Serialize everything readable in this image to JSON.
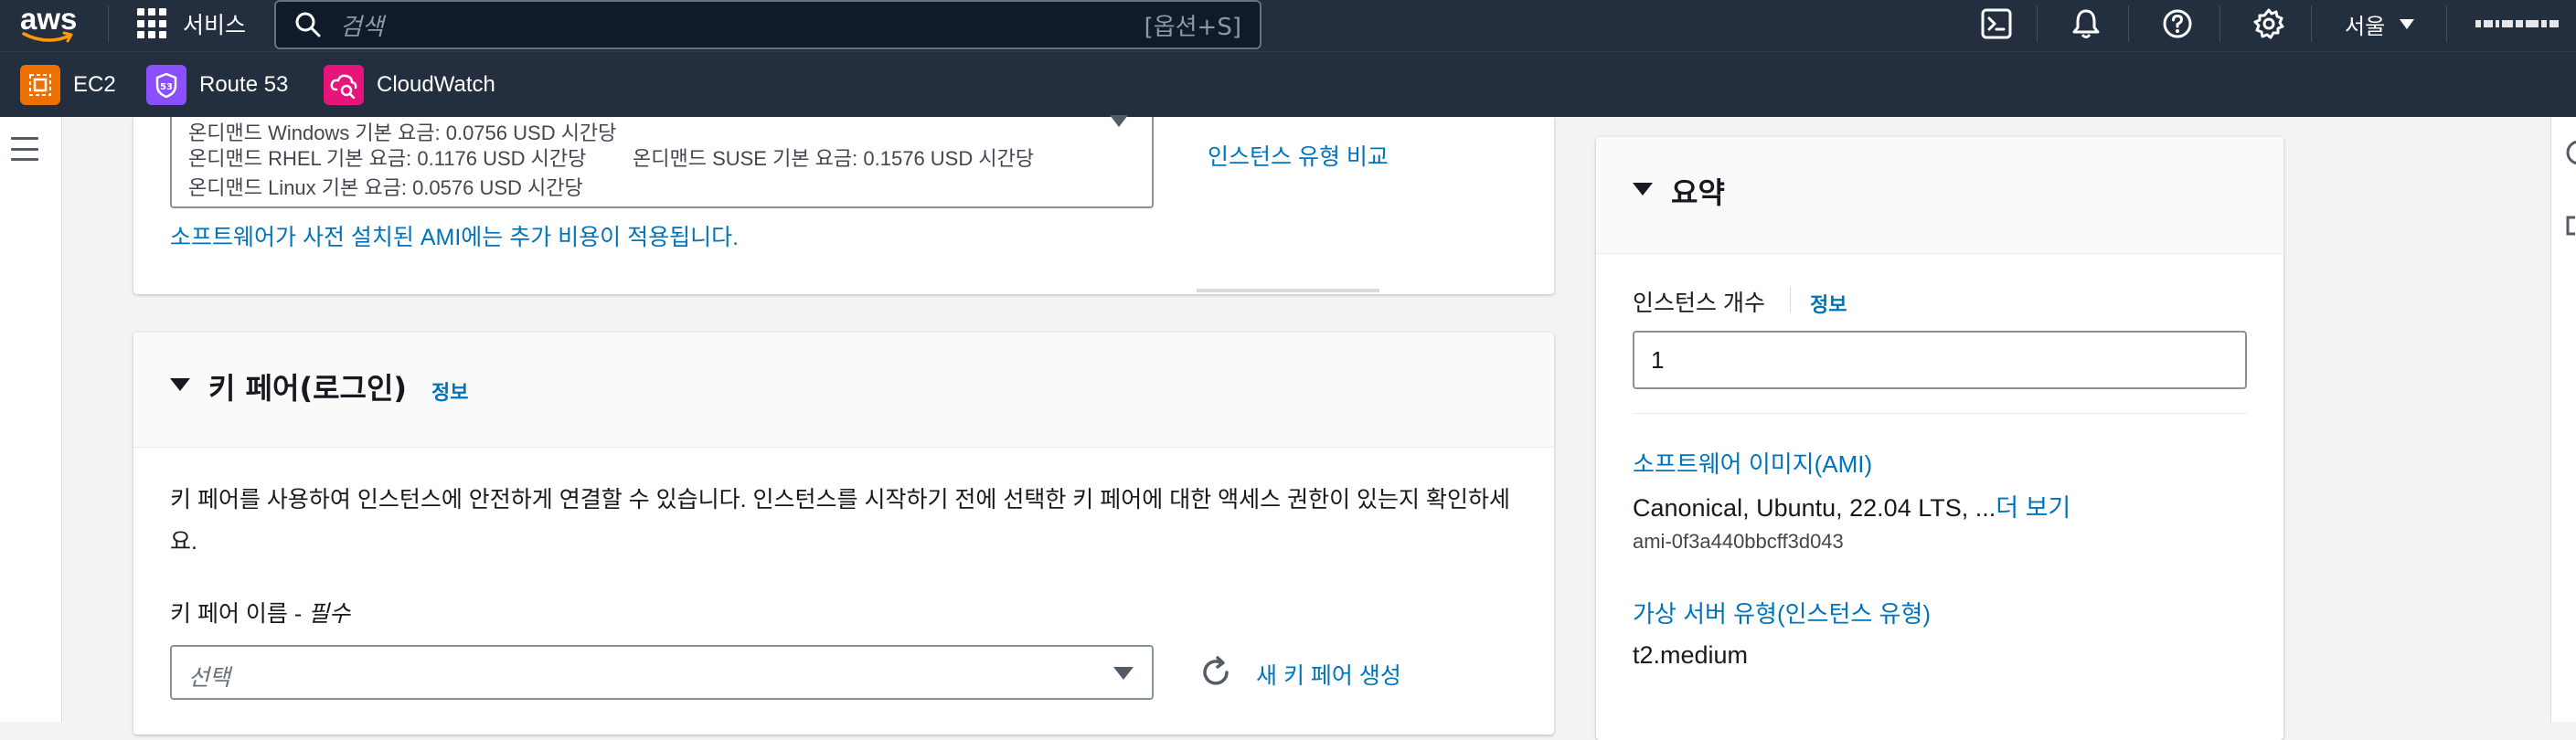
{
  "topnav": {
    "logo": "aws",
    "services_label": "서비스",
    "search_placeholder": "검색",
    "search_shortcut": "[옵션+S]",
    "region_label": "서울",
    "icons": [
      "cloudshell-icon",
      "bell-icon",
      "help-icon",
      "settings-icon"
    ]
  },
  "favorites": [
    {
      "label": "EC2",
      "icon": "ec2-icon",
      "color": "#ed7100"
    },
    {
      "label": "Route 53",
      "icon": "route53-icon",
      "color": "#8c4fff"
    },
    {
      "label": "CloudWatch",
      "icon": "cloudwatch-icon",
      "color": "#e7157b"
    }
  ],
  "instance_type_panel": {
    "price_windows": "온디맨드 Windows 기본 요금: 0.0756 USD 시간당",
    "price_rhel": "온디맨드 RHEL 기본 요금: 0.1176 USD 시간당",
    "price_suse": "온디맨드 SUSE 기본 요금: 0.1576 USD 시간당",
    "price_linux": "온디맨드 Linux 기본 요금: 0.0576 USD 시간당",
    "compare_link": "인스턴스 유형 비교",
    "ami_note": "소프트웨어가 사전 설치된 AMI에는 추가 비용이 적용됩니다."
  },
  "keypair_panel": {
    "title": "키 페어(로그인)",
    "info": "정보",
    "description": "키 페어를 사용하여 인스턴스에 안전하게 연결할 수 있습니다. 인스턴스를 시작하기 전에 선택한 키 페어에 대한 액세스 권한이 있는지 확인하세요.",
    "name_label": "키 페어 이름 - ",
    "required": "필수",
    "select_placeholder": "선택",
    "create_link": "새 키 페어 생성"
  },
  "summary": {
    "title": "요약",
    "count_label": "인스턴스 개수",
    "info": "정보",
    "count_value": "1",
    "ami_link": "소프트웨어 이미지(AMI)",
    "ami_name": "Canonical, Ubuntu, 22.04 LTS, ...",
    "ami_more": "더 보기",
    "ami_id": "ami-0f3a440bbcff3d043",
    "type_link": "가상 서버 유형(인스턴스 유형)",
    "type_value": "t2.medium"
  },
  "colors": {
    "nav_bg": "#232f3e",
    "link": "#0073bb",
    "page_bg": "#f2f3f3"
  }
}
